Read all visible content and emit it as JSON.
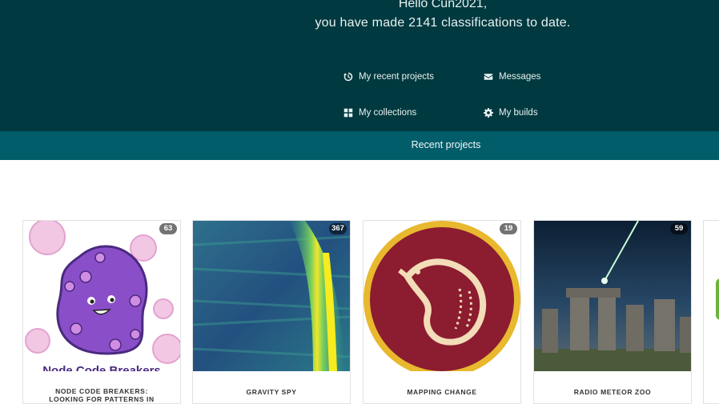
{
  "hero": {
    "greeting_line1": "Hello Cun2021,",
    "greeting_line2": "you have made 2141 classifications to date.",
    "links": [
      {
        "label": "My recent projects",
        "icon": "history-icon"
      },
      {
        "label": "Messages",
        "icon": "envelope-icon"
      },
      {
        "label": "My collections",
        "icon": "grid-icon"
      },
      {
        "label": "My builds",
        "icon": "gear-icon"
      }
    ]
  },
  "tabs": {
    "recent_projects": "Recent projects"
  },
  "projects": [
    {
      "title_line1": "NODE CODE BREAKERS:",
      "title_line2": "LOOKING FOR PATTERNS IN",
      "count": "63",
      "image_text": "Node Code Breakers"
    },
    {
      "title_line1": "GRAVITY SPY",
      "count": "367"
    },
    {
      "title_line1": "MAPPING CHANGE",
      "count": "19"
    },
    {
      "title_line1": "RADIO METEOR ZOO",
      "count": "59"
    }
  ],
  "colors": {
    "hero_bg": "#00393f",
    "tab_bg": "#005d69",
    "mapping_change_circle": "#8c1c30",
    "mapping_change_ring": "#e8b82e"
  }
}
